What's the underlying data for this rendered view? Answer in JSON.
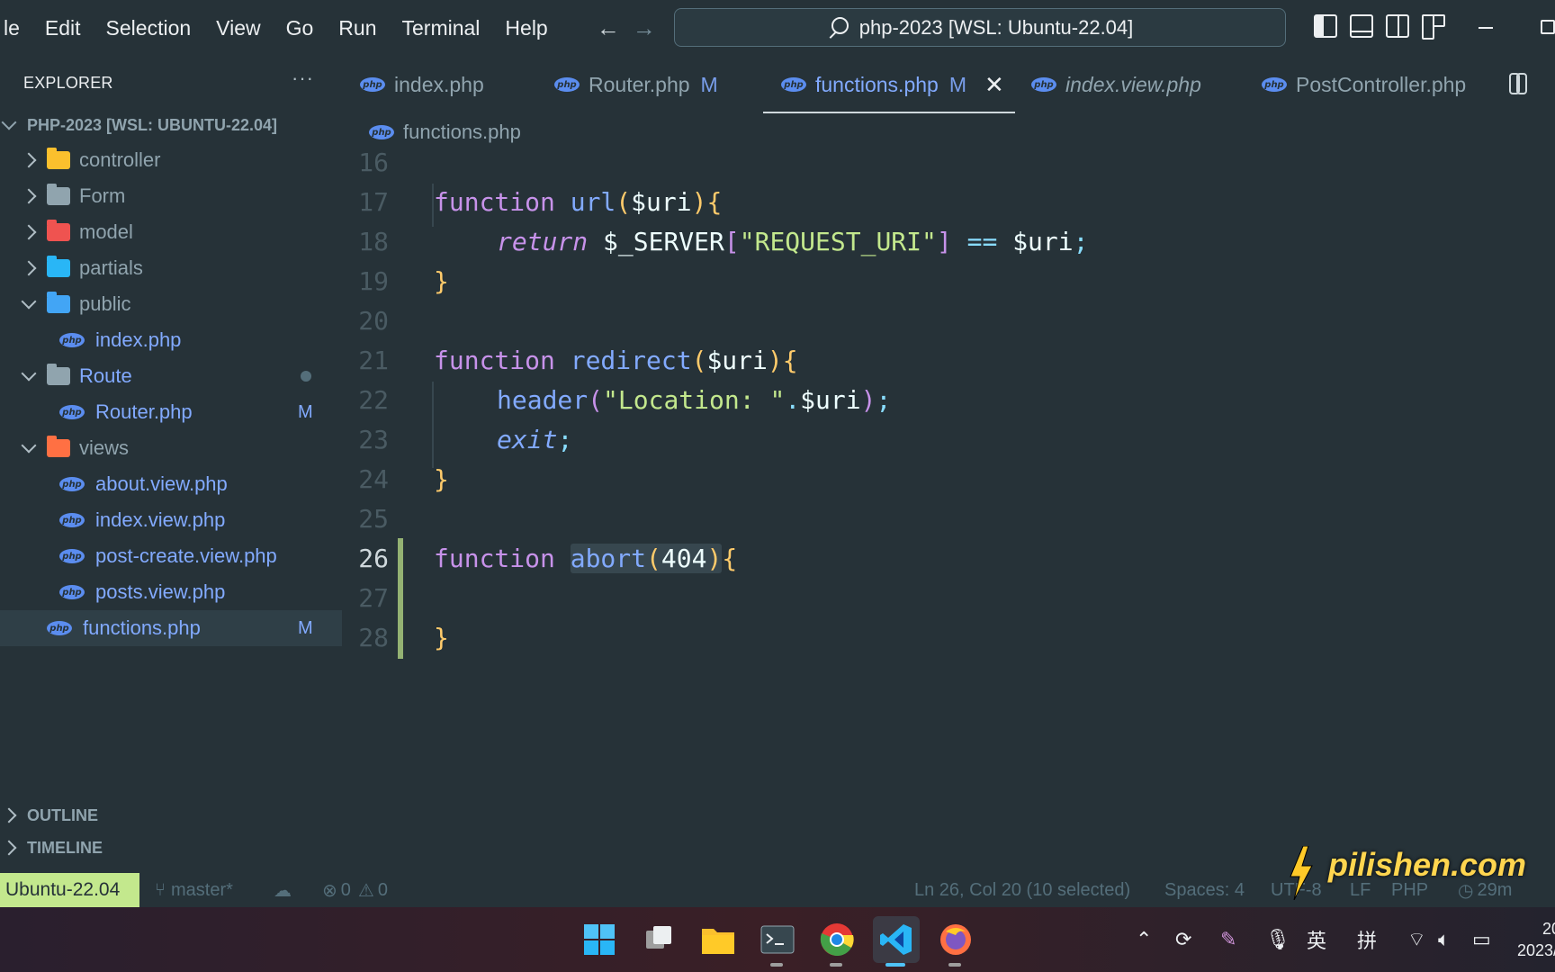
{
  "menu": [
    "le",
    "Edit",
    "Selection",
    "View",
    "Go",
    "Run",
    "Terminal",
    "Help"
  ],
  "nav": {
    "back": "←",
    "forward": "→"
  },
  "command_center": {
    "text": "php-2023 [WSL: Ubuntu-22.04]"
  },
  "sidebar": {
    "header": "EXPLORER",
    "more": "···",
    "root": "PHP-2023 [WSL: UBUNTU-22.04]",
    "items": [
      {
        "label": "controller",
        "type": "folder",
        "expanded": false,
        "color": "#fbc02d"
      },
      {
        "label": "Form",
        "type": "folder",
        "expanded": false,
        "color": "#90a4ae"
      },
      {
        "label": "model",
        "type": "folder",
        "expanded": false,
        "color": "#ef5350"
      },
      {
        "label": "partials",
        "type": "folder",
        "expanded": false,
        "color": "#29b6f6"
      },
      {
        "label": "public",
        "type": "folder",
        "expanded": true,
        "color": "#42a5f5"
      },
      {
        "label": "index.php",
        "type": "file"
      },
      {
        "label": "Route",
        "type": "folder",
        "expanded": true,
        "color": "#90a4ae"
      },
      {
        "label": "Router.php",
        "type": "file",
        "badge": "M"
      },
      {
        "label": "views",
        "type": "folder",
        "expanded": true,
        "color": "#ff7043"
      },
      {
        "label": "about.view.php",
        "type": "file"
      },
      {
        "label": "index.view.php",
        "type": "file"
      },
      {
        "label": "post-create.view.php",
        "type": "file"
      },
      {
        "label": "posts.view.php",
        "type": "file"
      },
      {
        "label": "functions.php",
        "type": "file",
        "badge": "M"
      }
    ],
    "outline": "OUTLINE",
    "timeline": "TIMELINE"
  },
  "tabs": [
    {
      "label": "index.php",
      "modified": "",
      "active": false,
      "preview": false
    },
    {
      "label": "Router.php",
      "modified": "M",
      "active": false,
      "preview": false
    },
    {
      "label": "functions.php",
      "modified": "M",
      "active": true,
      "preview": false
    },
    {
      "label": "index.view.php",
      "modified": "",
      "active": false,
      "preview": true
    },
    {
      "label": "PostController.php",
      "modified": "",
      "active": false,
      "preview": false
    }
  ],
  "tab_close": "✕",
  "php_icon_text": "php",
  "breadcrumb": {
    "file": "functions.php"
  },
  "editor": {
    "line_numbers": [
      "16",
      "17",
      "18",
      "19",
      "20",
      "21",
      "22",
      "23",
      "24",
      "25",
      "26",
      "27",
      "28"
    ],
    "current_line": "26",
    "code": {
      "l17": [
        "function",
        "url",
        "(",
        "$uri",
        ")",
        "{"
      ],
      "l18": [
        "return",
        "$_SERVER",
        "[",
        "\"REQUEST_URI\"",
        "]",
        "==",
        "$uri",
        ";"
      ],
      "l19": [
        "}"
      ],
      "l21": [
        "function",
        "redirect",
        "(",
        "$uri",
        ")",
        "{"
      ],
      "l22": [
        "header",
        "(",
        "\"Location: \"",
        ".",
        "$uri",
        ")",
        ";"
      ],
      "l23": [
        "exit",
        ";"
      ],
      "l24": [
        "}"
      ],
      "l26": [
        "function",
        "abort",
        "(",
        "404",
        ")",
        "{"
      ],
      "l28": [
        "}"
      ]
    }
  },
  "status": {
    "remote": "Ubuntu-22.04",
    "branch": "master*",
    "errors": "0",
    "warnings": "0",
    "position": "Ln 26, Col 20 (10 selected)",
    "spaces": "Spaces: 4",
    "encoding": "UTF-8",
    "eol": "LF",
    "language": "PHP",
    "time": "29m"
  },
  "watermark": "pilishen.com",
  "taskbar": {
    "apps": [
      "windows-start",
      "task-view",
      "file-explorer",
      "terminal",
      "chrome",
      "vscode",
      "firefox"
    ],
    "tray": {
      "ime_lang": "英",
      "ime_mode": "拼",
      "clock_partial": "20",
      "date_partial": "2023/"
    }
  },
  "colors": {
    "bg": "#263238",
    "keyword": "#c792ea",
    "function": "#82aaff",
    "string": "#c3e88d",
    "bracket": "#ffcb6b",
    "remote_bg": "#c3e88d"
  }
}
